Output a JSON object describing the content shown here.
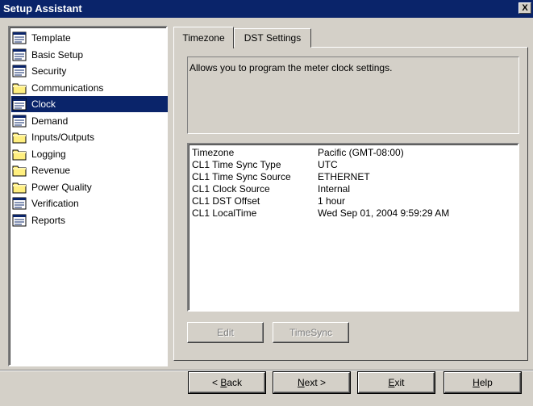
{
  "window": {
    "title": "Setup Assistant",
    "close_label": "X"
  },
  "colors": {
    "titlebar": "#0a246a",
    "selection": "#0a246a",
    "face": "#d4d0c8"
  },
  "tree": {
    "items": [
      {
        "label": "Template",
        "icon": "page-icon"
      },
      {
        "label": "Basic Setup",
        "icon": "page-icon"
      },
      {
        "label": "Security",
        "icon": "page-icon"
      },
      {
        "label": "Communications",
        "icon": "folder-icon"
      },
      {
        "label": "Clock",
        "icon": "page-icon",
        "selected": true
      },
      {
        "label": "Demand",
        "icon": "page-icon"
      },
      {
        "label": "Inputs/Outputs",
        "icon": "folder-icon"
      },
      {
        "label": "Logging",
        "icon": "folder-icon"
      },
      {
        "label": "Revenue",
        "icon": "folder-icon"
      },
      {
        "label": "Power Quality",
        "icon": "folder-icon"
      },
      {
        "label": "Verification",
        "icon": "page-icon"
      },
      {
        "label": "Reports",
        "icon": "page-icon"
      }
    ]
  },
  "tabs": [
    {
      "label": "Timezone",
      "active": true
    },
    {
      "label": "DST Settings",
      "active": false
    }
  ],
  "description": "Allows you to program the meter clock settings.",
  "properties": [
    {
      "key": "Timezone",
      "value": "Pacific (GMT-08:00)"
    },
    {
      "key": "CL1 Time Sync Type",
      "value": "UTC"
    },
    {
      "key": "CL1 Time Sync Source",
      "value": "ETHERNET"
    },
    {
      "key": "CL1 Clock Source",
      "value": "Internal"
    },
    {
      "key": "CL1 DST Offset",
      "value": "1 hour"
    },
    {
      "key": "CL1 LocalTime",
      "value": "Wed Sep 01, 2004 9:59:29 AM"
    }
  ],
  "actions": {
    "edit_label": "Edit",
    "timesync_label": "TimeSync"
  },
  "footer": {
    "back": {
      "pre": "< ",
      "key": "B",
      "rest": "ack"
    },
    "next": {
      "key": "N",
      "rest": "ext >"
    },
    "exit": {
      "key": "E",
      "rest": "xit"
    },
    "help": {
      "key": "H",
      "rest": "elp"
    }
  }
}
